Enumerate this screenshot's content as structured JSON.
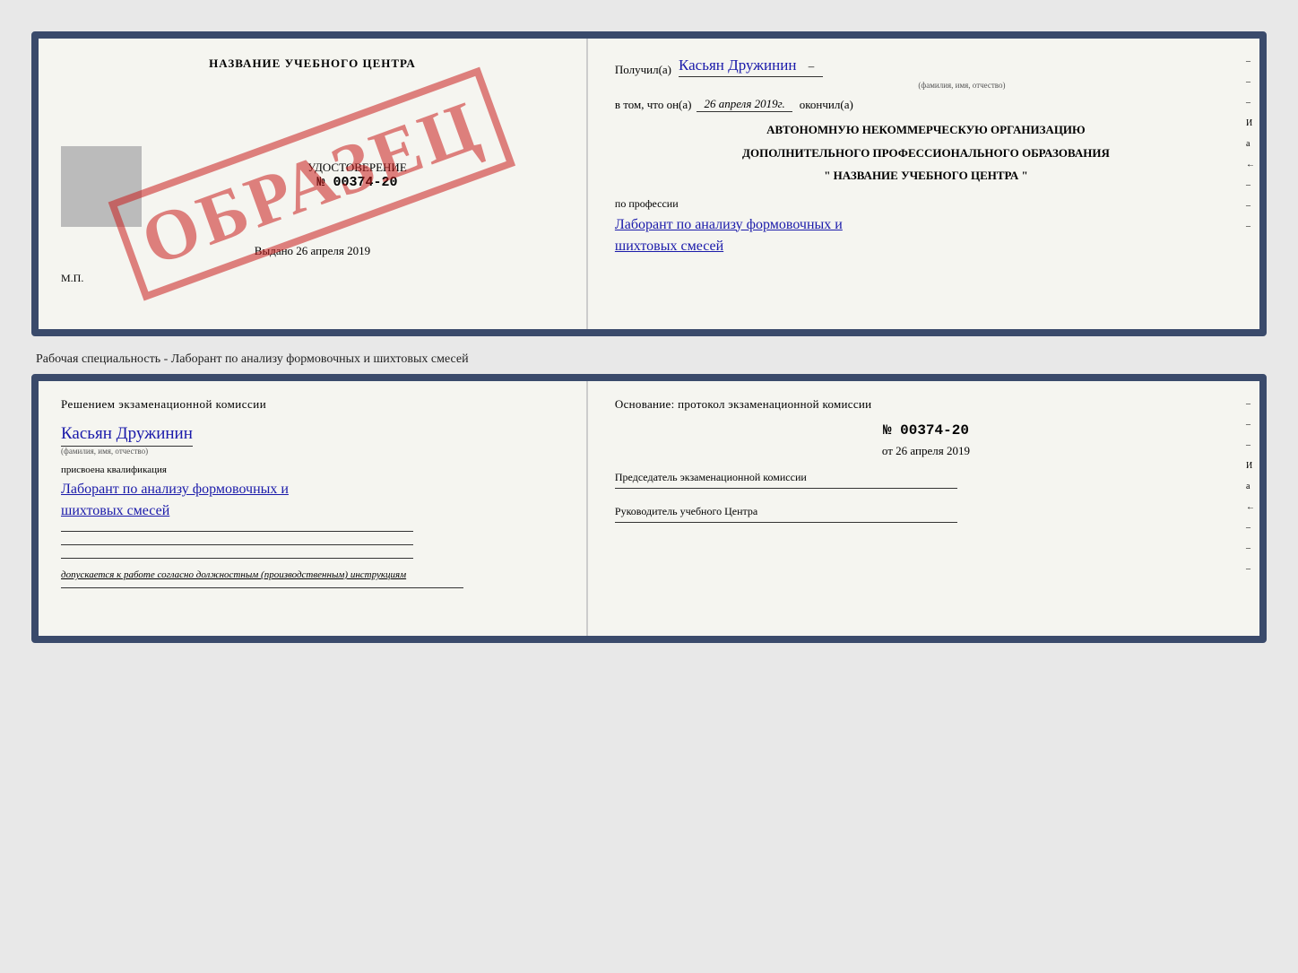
{
  "top_doc": {
    "left": {
      "title": "НАЗВАНИЕ УЧЕБНОГО ЦЕНТРА",
      "stamp": "ОБРАЗЕЦ",
      "gray_box_label": "",
      "uds_label": "УДОСТОВЕРЕНИЕ",
      "uds_number": "№ 00374-20",
      "vydano": "Выдано 26 апреля 2019",
      "mp": "М.П."
    },
    "right": {
      "poluchil_label": "Получил(а)",
      "poluchil_name": "Касьян Дружинин",
      "fio_label": "(фамилия, имя, отчество)",
      "vtom_label": "в том, что он(а)",
      "vtom_date": "26 апреля 2019г.",
      "okonchil": "окончил(а)",
      "org_line1": "АВТОНОМНУЮ НЕКОММЕРЧЕСКУЮ ОРГАНИЗАЦИЮ",
      "org_line2": "ДОПОЛНИТЕЛЬНОГО ПРОФЕССИОНАЛЬНОГО ОБРАЗОВАНИЯ",
      "org_name": "\" НАЗВАНИЕ УЧЕБНОГО ЦЕНТРА \"",
      "prof_label": "по профессии",
      "prof_handwritten": "Лаборант по анализу формовочных и",
      "prof_handwritten2": "шихтовых смесей",
      "right_marks": [
        "–",
        "–",
        "–",
        "И",
        "а",
        "←",
        "–",
        "–",
        "–"
      ]
    }
  },
  "specialty_line": "Рабочая специальность - Лаборант по анализу формовочных и шихтовых смесей",
  "bottom_doc": {
    "left": {
      "komissia_text": "Решением  экзаменационной  комиссии",
      "name_handwritten": "Касьян  Дружинин",
      "fio_label": "(фамилия, имя, отчество)",
      "kvalif_label": "присвоена квалификация",
      "kvalif_handwritten": "Лаборант по анализу формовочных и",
      "kvalif_handwritten2": "шихтовых смесей",
      "dopusk_text": "допускается к  работе согласно должностным (производственным) инструкциям"
    },
    "right": {
      "osnov_text": "Основание: протокол экзаменационной  комиссии",
      "protocol_number": "№  00374-20",
      "ot_text": "от 26 апреля 2019",
      "predsedatel_label": "Председатель экзаменационной комиссии",
      "rukovod_label": "Руководитель учебного Центра",
      "right_marks": [
        "–",
        "–",
        "–",
        "И",
        "а",
        "←",
        "–",
        "–",
        "–"
      ]
    }
  }
}
